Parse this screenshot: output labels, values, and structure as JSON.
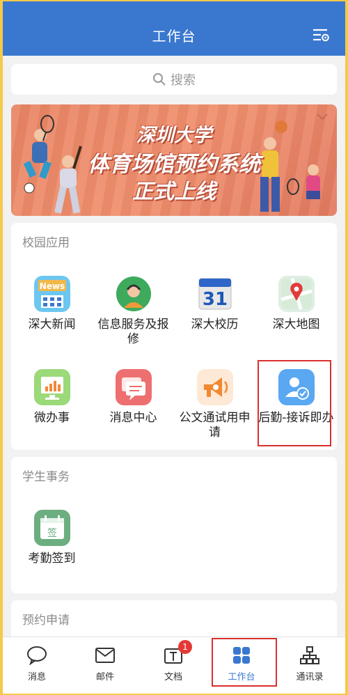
{
  "header": {
    "title": "工作台",
    "settings_icon": "settings-sliders-icon"
  },
  "search": {
    "placeholder": "搜索"
  },
  "banner": {
    "line1": "深圳大学",
    "line2": "体育场馆预约系统",
    "line3": "正式上线"
  },
  "campus": {
    "title": "校园应用",
    "apps": [
      {
        "label": "深大新闻",
        "icon": "news-icon"
      },
      {
        "label": "信息服务及报修",
        "icon": "customer-service-icon"
      },
      {
        "label": "深大校历",
        "icon": "calendar-icon",
        "calendar_number": "31"
      },
      {
        "label": "深大地图",
        "icon": "map-pin-icon"
      },
      {
        "label": "微办事",
        "icon": "bar-chart-icon"
      },
      {
        "label": "消息中心",
        "icon": "chat-bubbles-icon"
      },
      {
        "label": "公文通试用申请",
        "icon": "megaphone-icon"
      },
      {
        "label": "后勤-接诉即办",
        "icon": "user-check-icon"
      }
    ]
  },
  "student": {
    "title": "学生事务",
    "apps": [
      {
        "label": "考勤签到",
        "icon": "sign-in-calendar-icon",
        "icon_text": "签"
      }
    ]
  },
  "reservation": {
    "title": "预约申请"
  },
  "tabbar": {
    "items": [
      {
        "label": "消息",
        "icon": "chat-icon"
      },
      {
        "label": "邮件",
        "icon": "mail-icon"
      },
      {
        "label": "文档",
        "icon": "document-icon",
        "badge": "1"
      },
      {
        "label": "工作台",
        "icon": "grid-icon",
        "active": true
      },
      {
        "label": "通讯录",
        "icon": "org-chart-icon"
      }
    ]
  },
  "colors": {
    "primary": "#3a78cf",
    "highlight": "#d9302c",
    "badge": "#e53935"
  }
}
